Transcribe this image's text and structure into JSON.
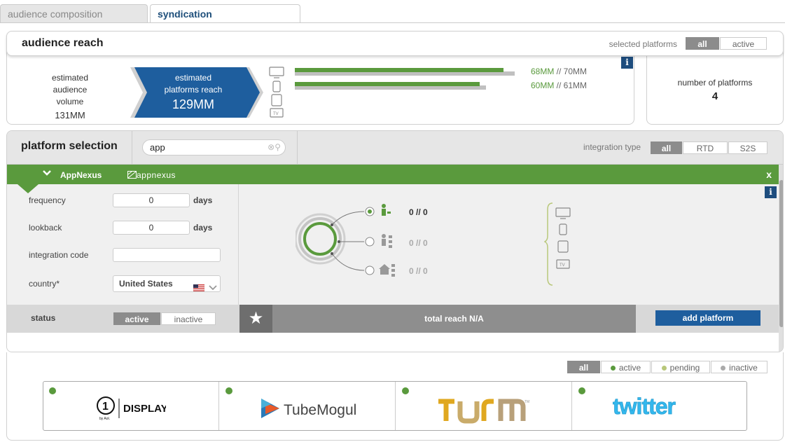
{
  "tabs": [
    {
      "label": "audience composition"
    },
    {
      "label": "syndication"
    }
  ],
  "reach": {
    "title": "audience reach",
    "selected_platforms_label": "selected platforms",
    "toggle_all": "all",
    "toggle_active": "active",
    "estimated_audience_label": "estimated audience volume",
    "estimated_audience_value": "131MM",
    "estimated_reach_label": "estimated platforms reach",
    "estimated_reach_value": "129MM",
    "devices": [
      {
        "icon": "desktop-icon",
        "green_fraction": 0.95,
        "gray_fraction": 1.0,
        "label_green": "68MM",
        "label_sep": " // ",
        "label_gray": "70MM"
      },
      {
        "icon": "mobile-icon",
        "green_fraction": 0.84,
        "gray_fraction": 0.87,
        "label_green": "60MM",
        "label_sep": " // ",
        "label_gray": "61MM"
      }
    ],
    "info_label": "i",
    "platforms_count_label": "number of platforms",
    "platforms_count_value": "4"
  },
  "platform_selection": {
    "title": "platform selection",
    "search_value": "app",
    "integration_type_label": "integration type",
    "integration_types": [
      "all",
      "RTD",
      "S2S"
    ],
    "platform_name": "AppNexus",
    "platform_logo": "appnexus",
    "close_label": "x",
    "form": {
      "frequency_label": "frequency",
      "frequency_value": "0",
      "lookback_label": "lookback",
      "lookback_value": "0",
      "days_label": "days",
      "integration_code_label": "integration code",
      "integration_code_value": "",
      "country_label": "country*",
      "country_value": "United States"
    },
    "reach_rows": [
      {
        "value": "0 // 0",
        "color": "#5a9a3d"
      },
      {
        "value": "0 // 0",
        "color": "#aaaaaa"
      },
      {
        "value": "0 // 0",
        "color": "#aaaaaa"
      }
    ],
    "status_label": "status",
    "status_active": "active",
    "status_inactive": "inactive",
    "total_reach": "total reach N/A",
    "add_platform": "add platform",
    "info_label": "i"
  },
  "bottom": {
    "filters": [
      "all",
      "active",
      "pending",
      "inactive"
    ],
    "filter_colors": [
      "",
      "#5a9a3d",
      "#b8c77a",
      "#aaaaaa"
    ],
    "logos": [
      {
        "name": "DISPLAY",
        "sub": "by Aol."
      },
      {
        "name": "TubeMogul"
      },
      {
        "name": "TURN"
      },
      {
        "name": "twitter"
      }
    ]
  },
  "colors": {
    "green": "#5a9a3d",
    "blue": "#1e5e9e",
    "navy": "#1e4d7e"
  }
}
